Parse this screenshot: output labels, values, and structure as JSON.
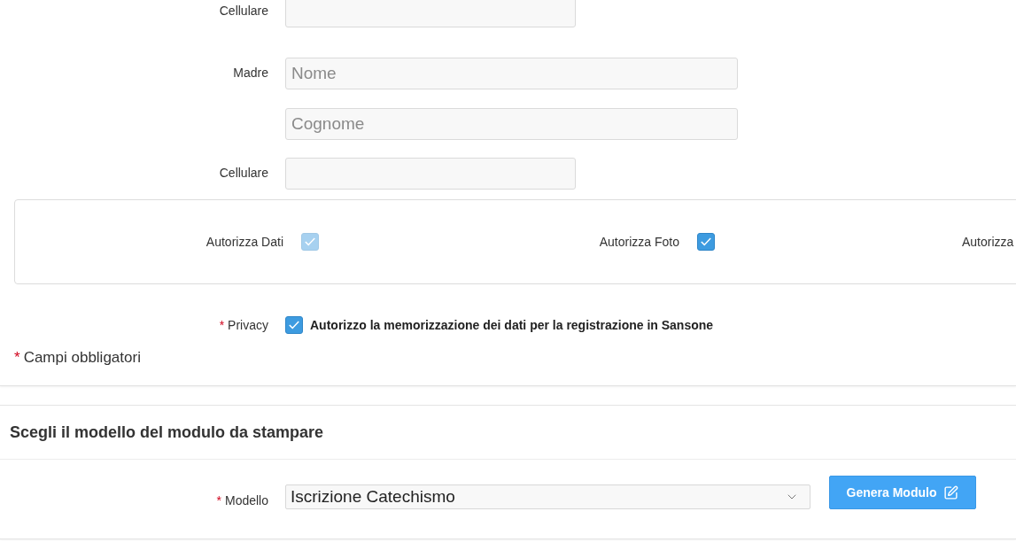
{
  "mobile_1": {
    "label": "Cellulare"
  },
  "mother": {
    "label": "Madre",
    "first_name": {
      "placeholder": "Nome"
    },
    "last_name": {
      "placeholder": "Cognome"
    }
  },
  "mobile_2": {
    "label": "Cellulare"
  },
  "authorizations": {
    "items": [
      {
        "label": "Autorizza Dati",
        "checked": true,
        "disabled": true
      },
      {
        "label": "Autorizza Foto",
        "checked": true,
        "disabled": false
      }
    ],
    "cut_label": "Autorizza"
  },
  "privacy": {
    "required_mark": "*",
    "label": "Privacy",
    "checked": true,
    "text": "Autorizzo la memorizzazione dei dati per la registrazione in Sansone"
  },
  "required_note": {
    "mark": "*",
    "text": "Campi obbligatori"
  },
  "template_section": {
    "title": "Scegli il modello del modulo da stampare",
    "field": {
      "required_mark": "*",
      "label": "Modello",
      "value": "Iscrizione Catechismo"
    },
    "button": {
      "label": "Genera Modulo"
    }
  }
}
